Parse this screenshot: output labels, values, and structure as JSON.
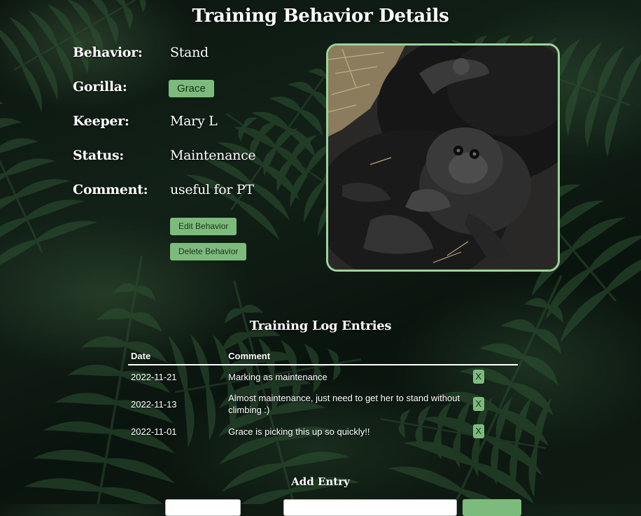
{
  "page": {
    "title": "Training Behavior Details"
  },
  "details": {
    "behavior_label": "Behavior:",
    "behavior_value": "Stand",
    "gorilla_label": "Gorilla:",
    "gorilla_value": "Grace",
    "keeper_label": "Keeper:",
    "keeper_value": "Mary L",
    "status_label": "Status:",
    "status_value": "Maintenance",
    "comment_label": "Comment:",
    "comment_value": "useful for PT"
  },
  "actions": {
    "edit_label": "Edit Behavior",
    "delete_label": "Delete Behavior"
  },
  "photo": {
    "subject": "baby gorilla resting on adult gorilla",
    "frame_color": "#9bd39b"
  },
  "log": {
    "title": "Training Log Entries",
    "columns": [
      "Date",
      "Comment"
    ],
    "delete_label": "X",
    "rows": [
      {
        "date": "2022-11-21",
        "comment": "Marking as maintenance"
      },
      {
        "date": "2022-11-13",
        "comment": "Almost maintenance, just need to get her to stand without climbing :)"
      },
      {
        "date": "2022-11-01",
        "comment": "Grace is picking this up so quickly!!"
      }
    ]
  },
  "add_entry": {
    "title": "Add Entry"
  },
  "colors": {
    "accent": "#7dbb7d",
    "accent_text": "#15301a",
    "background": "#0f1b12",
    "text": "#ffffff"
  }
}
